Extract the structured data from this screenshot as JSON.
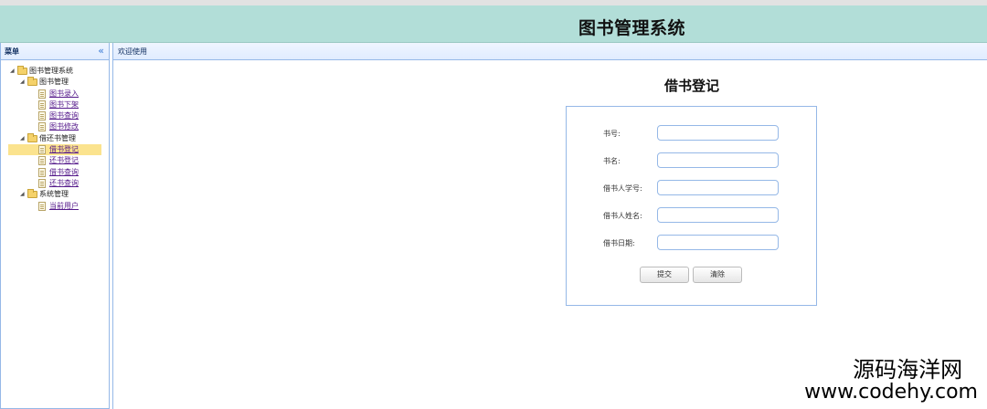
{
  "header": {
    "title": "图书管理系统"
  },
  "sidebar": {
    "title": "菜单",
    "collapse_icon": "double-chevron-left-icon",
    "tree": {
      "root": "图书管理系统",
      "groups": [
        {
          "label": "图书管理",
          "items": [
            "图书录入",
            "图书下架",
            "图书查询",
            "图书修改"
          ]
        },
        {
          "label": "借还书管理",
          "items": [
            "借书登记",
            "还书登记",
            "借书查询",
            "还书查询"
          ]
        },
        {
          "label": "系统管理",
          "items": [
            "当前用户"
          ]
        }
      ],
      "selected": "借书登记"
    }
  },
  "main": {
    "tab_title": "欢迎使用",
    "form": {
      "title": "借书登记",
      "fields": [
        {
          "label": "书号:",
          "value": ""
        },
        {
          "label": "书名:",
          "value": ""
        },
        {
          "label": "借书人学号:",
          "value": ""
        },
        {
          "label": "借书人姓名:",
          "value": ""
        },
        {
          "label": "借书日期:",
          "value": ""
        }
      ],
      "submit_label": "提交",
      "clear_label": "清除"
    }
  },
  "watermark": {
    "line1": "源码海洋网",
    "line2": "www.codehy.com"
  },
  "colors": {
    "header_bg": "#b2ded8",
    "border": "#95b8e7",
    "selected_bg": "#fbe38e"
  }
}
